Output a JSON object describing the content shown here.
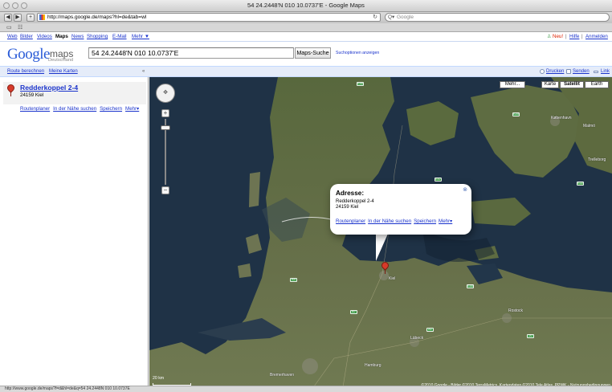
{
  "window": {
    "title": "54 24.2448'N 010 10.0737'E - Google Maps"
  },
  "browser": {
    "back_label": "◀",
    "forward_label": "▶",
    "add_label": "+",
    "url": "http://maps.google.de/maps?hl=de&tab=wl",
    "reload_icon": "reload-icon",
    "search_placeholder": "Google",
    "bookmarks": [
      "▭",
      "☷"
    ]
  },
  "gnav": {
    "items": [
      "Web",
      "Bilder",
      "Videos",
      "Maps",
      "News",
      "Shopping",
      "E-Mail",
      "Mehr ▼"
    ],
    "active": "Maps",
    "new_label": "Neu!",
    "help_label": "Hilfe",
    "login_label": "Anmelden",
    "sep": "|"
  },
  "header": {
    "logo": "Google",
    "logo_maps": "maps",
    "logo_country": "Deutschland",
    "query": "54 24.2448'N 010 10.0737'E",
    "search_button": "Maps-Suche",
    "options_link": "Suchoptionen anzeigen"
  },
  "actionbar": {
    "route": "Route berechnen",
    "my_maps": "Meine Karten",
    "collapse": "«",
    "print": "Drucken",
    "send": "Senden",
    "link": "Link"
  },
  "result": {
    "title": "Redderkoppel 2-4",
    "address": "24159 Kiel",
    "links": [
      "Routenplaner",
      "In der Nähe suchen",
      "Speichern",
      "Mehr▾"
    ]
  },
  "map": {
    "types": [
      "Mehr...",
      "Karte",
      "Satellit",
      "Earth"
    ],
    "active_type": "Satellit",
    "pan_label": "✥",
    "zoom_in": "+",
    "zoom_out": "−",
    "scale": "20 km",
    "scale_miles": "10 Meilen",
    "copyright": "©2010 Google - Bilder ©2010 TerraMetrics, Kartendaten ©2010 Tele Atlas, PPWK - Nutzungsbedingungen",
    "place_labels": [
      "København",
      "Malmö",
      "Trelleborg",
      "Rostock",
      "Hamburg",
      "Bremerhaven",
      "Lübeck",
      "Kiel"
    ],
    "road_badges": [
      "E45",
      "E20",
      "E47",
      "E22",
      "E55",
      "A1",
      "A7",
      "20",
      "B4"
    ]
  },
  "info": {
    "heading": "Adresse:",
    "line1": "Redderkoppel 2-4",
    "line2": "24159 Kiel",
    "links": [
      "Routenplaner",
      "In der Nähe suchen",
      "Speichern",
      "Mehr▾"
    ],
    "close": "⊗"
  },
  "statusbar": {
    "text": "http://www.google.de/maps?f=d&hl=de&q=54 24.2448N 010 10.0737E"
  },
  "colors": {
    "link": "#1a33cc",
    "new": "#dd2200",
    "water": "#1f3246",
    "land": "#5b6b3f",
    "pin": "#d63a2a"
  }
}
